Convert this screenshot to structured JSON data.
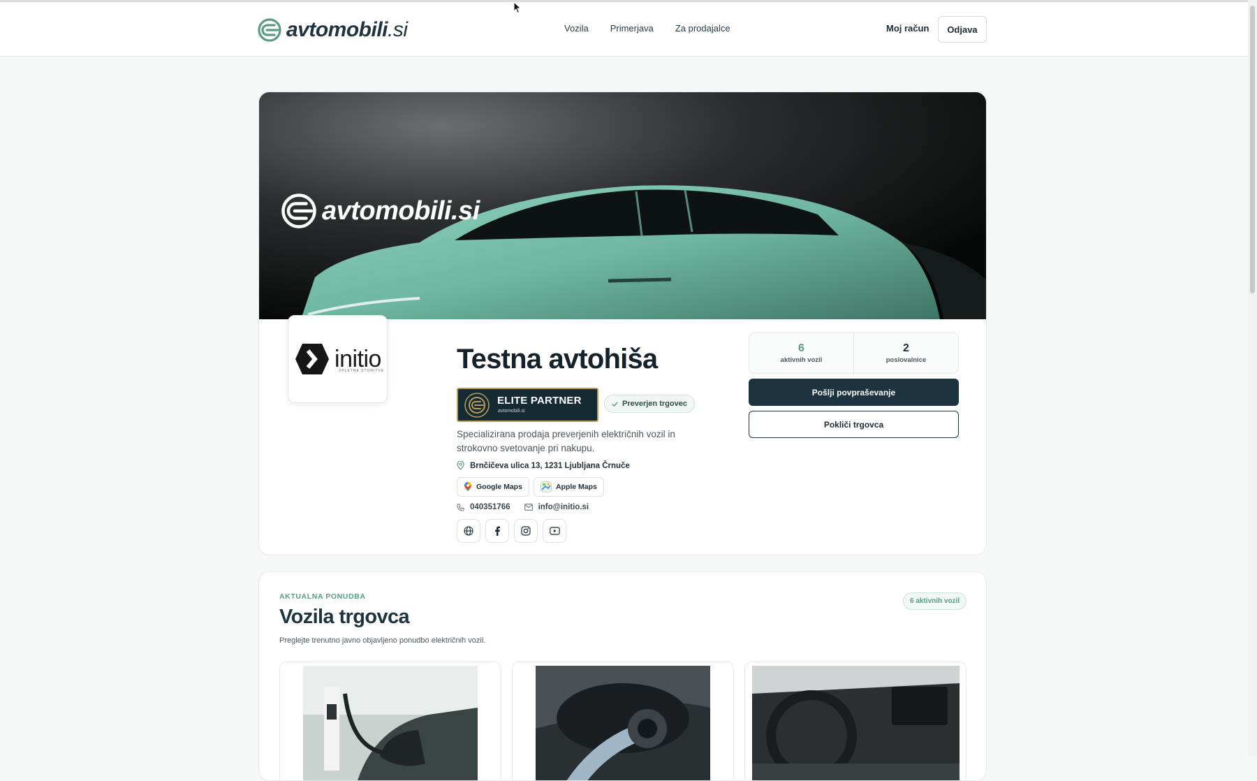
{
  "brand": {
    "name": "avtomobili",
    "tld": ".si"
  },
  "nav": {
    "items": [
      "Vozila",
      "Primerjava",
      "Za prodajalce"
    ]
  },
  "account": {
    "my_account": "Moj račun",
    "logout": "Odjava"
  },
  "hero": {
    "brand_name": "avtomobili",
    "brand_tld": ".si"
  },
  "dealer": {
    "logo_name": "initio",
    "logo_tagline": "SPLETNE STORITVE",
    "name": "Testna avtohiša",
    "elite_badge": "ELITE PARTNER",
    "elite_sub": "avtomobili.si",
    "verified_badge": "Preverjen trgovec",
    "description": "Specializirana prodaja preverjenih električnih vozil in strokovno svetovanje pri nakupu.",
    "address": "Brnčičeva ulica 13, 1231 Ljubljana Črnuče",
    "maps": [
      "Google Maps",
      "Apple Maps"
    ],
    "phone": "040351766",
    "email": "info@initio.si",
    "socials": [
      "globe-icon",
      "facebook-icon",
      "instagram-icon",
      "youtube-icon"
    ]
  },
  "stats": [
    {
      "value": "6",
      "label": "aktivnih vozil",
      "color": "#5b9a86"
    },
    {
      "value": "2",
      "label": "poslovalnice",
      "color": "#1c2a33"
    }
  ],
  "actions": {
    "inquiry": "Pošlji povpraševanje",
    "call": "Pokliči trgovca"
  },
  "vehicles": {
    "eyebrow": "AKTUALNA PONUDBA",
    "title": "Vozila trgovca",
    "subtitle": "Preglejte trenutno javno objavljeno ponudbo električnih vozil.",
    "count_badge": "6 aktivnih vozil"
  },
  "colors": {
    "accent": "#5b9a86",
    "dark": "#1d3440",
    "gold": "#b8a05a",
    "car": "#7cc3ad"
  }
}
